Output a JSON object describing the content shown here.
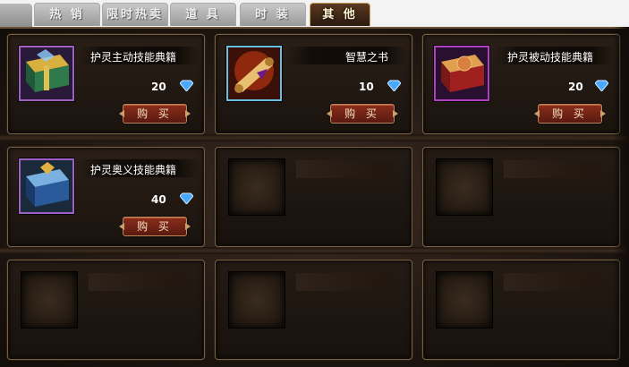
{
  "tabs": [
    {
      "label": "热 销",
      "active": false
    },
    {
      "label": "限时热卖",
      "active": false
    },
    {
      "label": "道 具",
      "active": false
    },
    {
      "label": "时 装",
      "active": false
    },
    {
      "label": "其 他",
      "active": true
    }
  ],
  "items": [
    {
      "name": "护灵主动技能典籍",
      "price": "20",
      "buy_label": "购 买",
      "icon": "green-gold-book-icon"
    },
    {
      "name": "智慧之书",
      "price": "10",
      "buy_label": "购 买",
      "icon": "scroll-icon"
    },
    {
      "name": "护灵被动技能典籍",
      "price": "20",
      "buy_label": "购 买",
      "icon": "red-book-icon"
    },
    {
      "name": "护灵奥义技能典籍",
      "price": "40",
      "buy_label": "购 买",
      "icon": "blue-book-icon"
    }
  ],
  "currency_icon": "diamond-icon",
  "colors": {
    "accent": "#c9a25a",
    "button": "#7a2a18",
    "background": "#1c140f"
  }
}
